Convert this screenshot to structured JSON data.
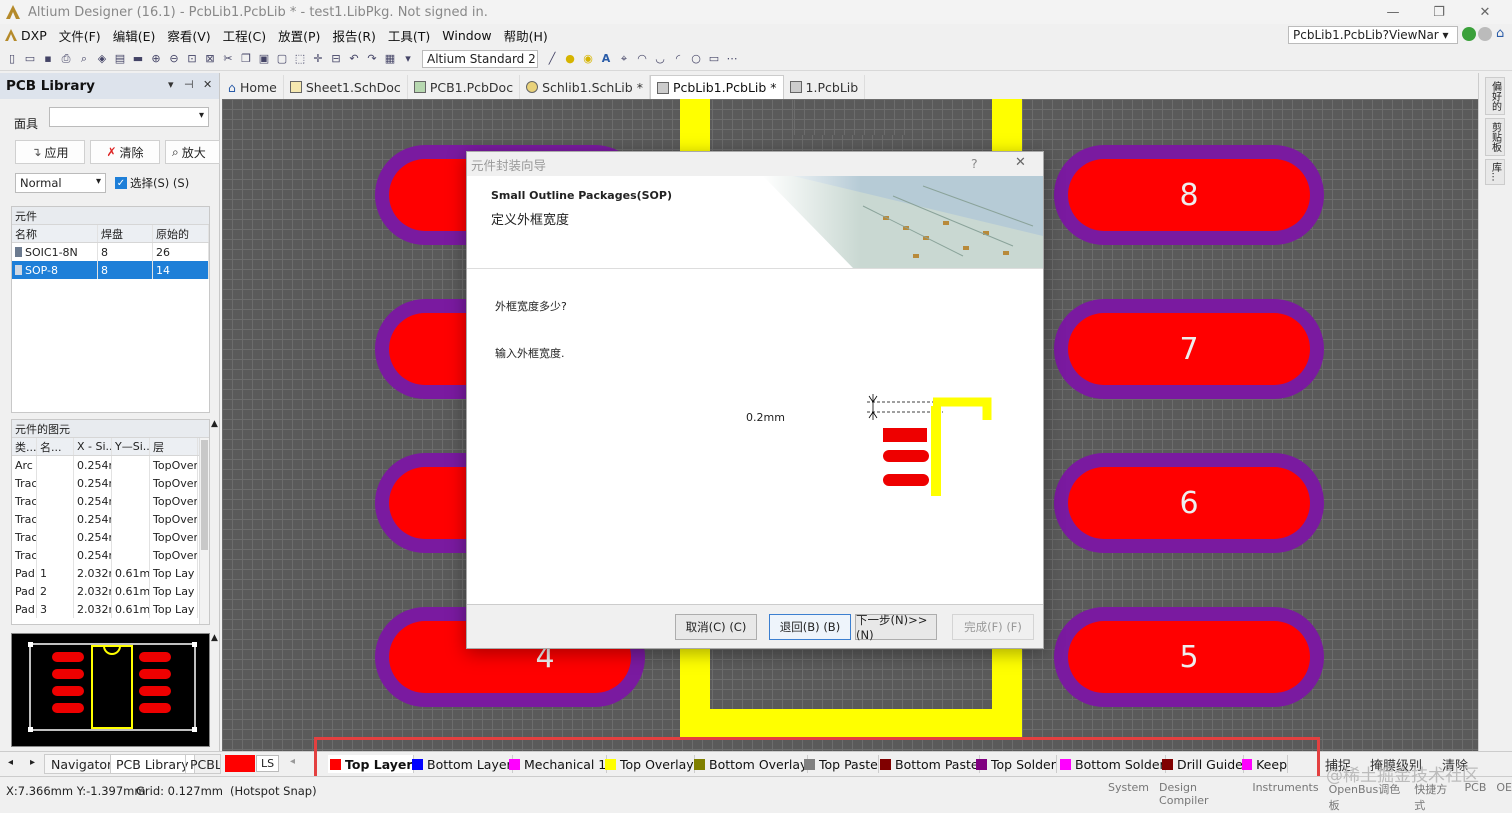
{
  "window": {
    "title": "Altium Designer (16.1) - PcbLib1.PcbLib * - test1.LibPkg. Not signed in.",
    "controls": {
      "minimize": "—",
      "restore": "❐",
      "close": "✕"
    }
  },
  "menu": {
    "items": [
      "DXP",
      "文件(F)",
      "编辑(E)",
      "察看(V)",
      "工程(C)",
      "放置(P)",
      "报告(R)",
      "工具(T)",
      "Window",
      "帮助(H)"
    ],
    "nav_address": "PcbLib1.PcbLib?ViewNar ▾"
  },
  "toolbar": {
    "standard_select": "Altium Standard 2 ▾"
  },
  "left_panel": {
    "title": "PCB Library",
    "mask_label": "面具",
    "mask_value": "",
    "btn_apply": "应用",
    "btn_clear": "清除",
    "btn_zoom": "放大",
    "mode_select": "Normal",
    "select_checkbox": "选择(S) (S)",
    "components": {
      "section": "元件",
      "headers": [
        "名称",
        "焊盘",
        "原始的"
      ],
      "rows": [
        {
          "name": "SOIC1-8N",
          "pads": "8",
          "prims": "26"
        },
        {
          "name": "SOP-8",
          "pads": "8",
          "prims": "14"
        }
      ]
    },
    "primitives": {
      "section": "元件的图元",
      "headers": [
        "类...",
        "名...",
        "X - Si...",
        "Y—Si...",
        "层"
      ],
      "rows": [
        [
          "Arc",
          "",
          "0.254m",
          "",
          "TopOver"
        ],
        [
          "Track",
          "",
          "0.254m",
          "",
          "TopOver"
        ],
        [
          "Track",
          "",
          "0.254m",
          "",
          "TopOver"
        ],
        [
          "Track",
          "",
          "0.254m",
          "",
          "TopOver"
        ],
        [
          "Track",
          "",
          "0.254m",
          "",
          "TopOver"
        ],
        [
          "Track",
          "",
          "0.254m",
          "",
          "TopOver"
        ],
        [
          "Pad",
          "1",
          "2.032m",
          "0.61mr",
          "Top Lay"
        ],
        [
          "Pad",
          "2",
          "2.032m",
          "0.61mr",
          "Top Lay"
        ],
        [
          "Pad",
          "3",
          "2.032m",
          "0.61mr",
          "Top Lay"
        ]
      ]
    },
    "bottom_tabs": [
      "Navigator",
      "PCB Library",
      "PCBLi"
    ]
  },
  "doc_tabs": [
    {
      "label": "Home",
      "active": false
    },
    {
      "label": "Sheet1.SchDoc",
      "active": false
    },
    {
      "label": "PCB1.PcbDoc",
      "active": false
    },
    {
      "label": "Schlib1.SchLib *",
      "active": false
    },
    {
      "label": "PcbLib1.PcbLib *",
      "active": true
    },
    {
      "label": "1.PcbLib",
      "active": false
    }
  ],
  "pads": [
    "8",
    "7",
    "6",
    "5",
    "4"
  ],
  "right_strip": [
    "偏好的",
    "剪贴板",
    "库..."
  ],
  "dialog": {
    "title": "元件封装向导",
    "help": "?",
    "close": "✕",
    "heading": "Small Outline Packages(SOP)",
    "subheading": "定义外框宽度",
    "question": "外框宽度多少?",
    "instruction": "输入外框宽度.",
    "width_value": "0.2mm",
    "buttons": {
      "cancel": "取消(C) (C)",
      "back": "退回(B) (B)",
      "next": "下一步(N)>> (N)",
      "finish": "完成(F) (F)"
    }
  },
  "layer_bar": {
    "ls": "LS",
    "layers": [
      {
        "name": "Top Layer",
        "color": "#ff0000",
        "active": true
      },
      {
        "name": "Bottom Layer",
        "color": "#0000ff",
        "active": false
      },
      {
        "name": "Mechanical 1",
        "color": "#ff00ff",
        "active": false
      },
      {
        "name": "Top Overlay",
        "color": "#ffff00",
        "active": false
      },
      {
        "name": "Bottom Overlay",
        "color": "#808000",
        "active": false
      },
      {
        "name": "Top Paste",
        "color": "#808080",
        "active": false
      },
      {
        "name": "Bottom Paste",
        "color": "#800000",
        "active": false
      },
      {
        "name": "Top Solder",
        "color": "#800080",
        "active": false
      },
      {
        "name": "Bottom Solder",
        "color": "#ff00ff",
        "active": false
      },
      {
        "name": "Drill Guide",
        "color": "#800000",
        "active": false
      },
      {
        "name": "Keep",
        "color": "#ff00ff",
        "active": false
      }
    ],
    "right_items": [
      "捕捉",
      "掩膜级别",
      "清除"
    ]
  },
  "status": {
    "coords": "X:7.366mm Y:-1.397mm",
    "grid": "Grid: 0.127mm",
    "snap": "(Hotspot Snap)",
    "right_items": [
      "System",
      "Design Compiler",
      "Instruments",
      "OpenBus调色板",
      "快捷方式",
      "PCB",
      "OE"
    ],
    "watermark": "@稀土掘金技术社区"
  },
  "colors": {
    "pad": "#ff0000",
    "solder": "#7a1aa0",
    "overlay": "#ffff00",
    "selection": "#1e7fd8"
  }
}
